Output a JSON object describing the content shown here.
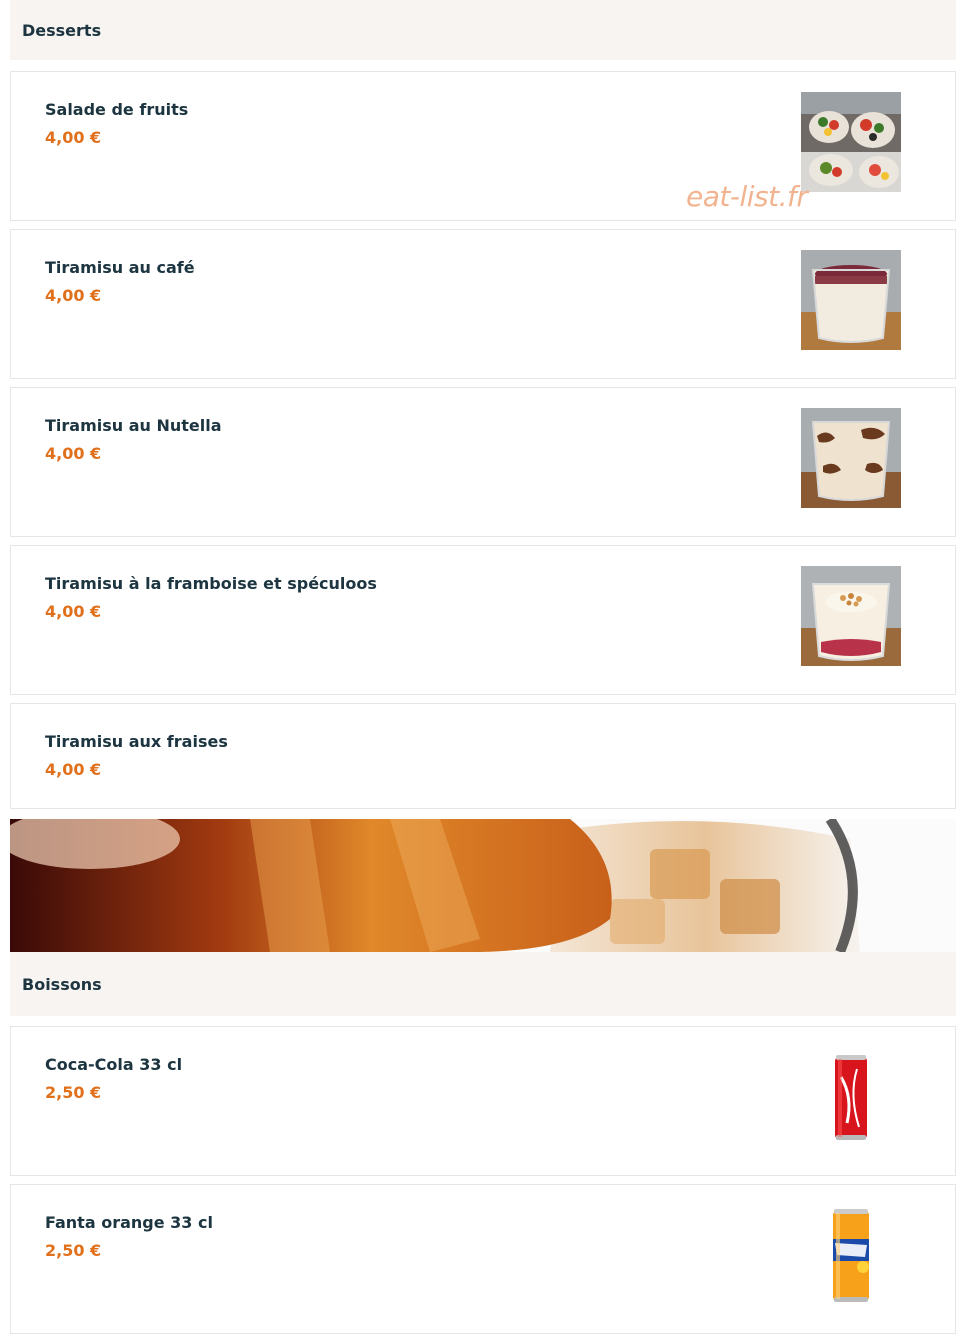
{
  "watermark": "eat-list.fr",
  "sections": {
    "desserts": {
      "title": "Desserts",
      "items": [
        {
          "name": "Salade de fruits",
          "price": "4,00 €",
          "image": "fruit-salad-cups"
        },
        {
          "name": "Tiramisu au café",
          "price": "4,00 €",
          "image": "coffee-tiramisu-cup"
        },
        {
          "name": "Tiramisu au Nutella",
          "price": "4,00 €",
          "image": "nutella-tiramisu-cup"
        },
        {
          "name": "Tiramisu à la framboise et spéculoos",
          "price": "4,00 €",
          "image": "raspberry-speculoos-tiramisu-cup"
        },
        {
          "name": "Tiramisu aux fraises",
          "price": "4,00 €",
          "image": ""
        }
      ]
    },
    "boissons": {
      "title": "Boissons",
      "banner_image": "cola-pouring-banner",
      "items": [
        {
          "name": "Coca-Cola 33 cl",
          "price": "2,50 €",
          "image": "coca-cola-can"
        },
        {
          "name": "Fanta orange 33 cl",
          "price": "2,50 €",
          "image": "fanta-orange-can"
        }
      ]
    }
  },
  "colors": {
    "accent_price": "#e0701b",
    "text_dark": "#1c3540",
    "header_bg": "#f7f4f1",
    "border": "#e6e6e6"
  }
}
